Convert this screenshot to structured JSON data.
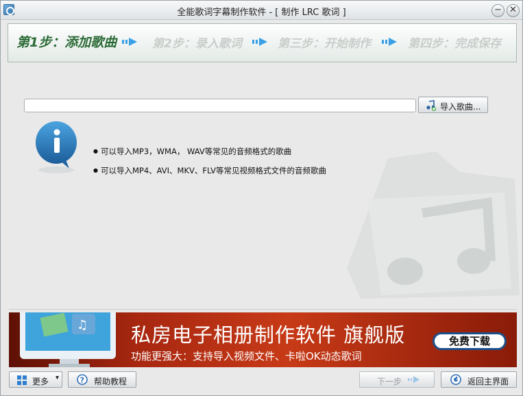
{
  "window": {
    "title": "全能歌词字幕制作软件 - [ 制作 LRC 歌词 ]",
    "minimize_symbol": "−",
    "close_symbol": "✕"
  },
  "steps": [
    {
      "label": "第1步：添加歌曲",
      "active": true
    },
    {
      "label": "第2步：录入歌词",
      "active": false
    },
    {
      "label": "第三步：开始制作",
      "active": false
    },
    {
      "label": "第四步：完成保存",
      "active": false
    }
  ],
  "song_input": {
    "value": "",
    "placeholder": ""
  },
  "import_button": {
    "label": "导入歌曲...",
    "icon": "music-add-icon"
  },
  "info": {
    "icon": "info-icon",
    "bullets": [
      "可以导入MP3，WMA， WAV等常见的音频格式的歌曲",
      "可以导入MP4、AVI、MKV、FLV等常见视频格式文件的音频歌曲"
    ]
  },
  "ad": {
    "title": "私房电子相册制作软件 旗舰版",
    "subtitle": "功能更强大：支持导入视频文件、卡啦OK动态歌词",
    "button": "免费下载"
  },
  "footer": {
    "more": "更多",
    "help": "帮助教程",
    "next": "下一步",
    "home": "返回主界面"
  },
  "colors": {
    "active_step": "#2c6b36",
    "inactive_step": "#c8cdca",
    "ad_background": "#b02d12"
  }
}
